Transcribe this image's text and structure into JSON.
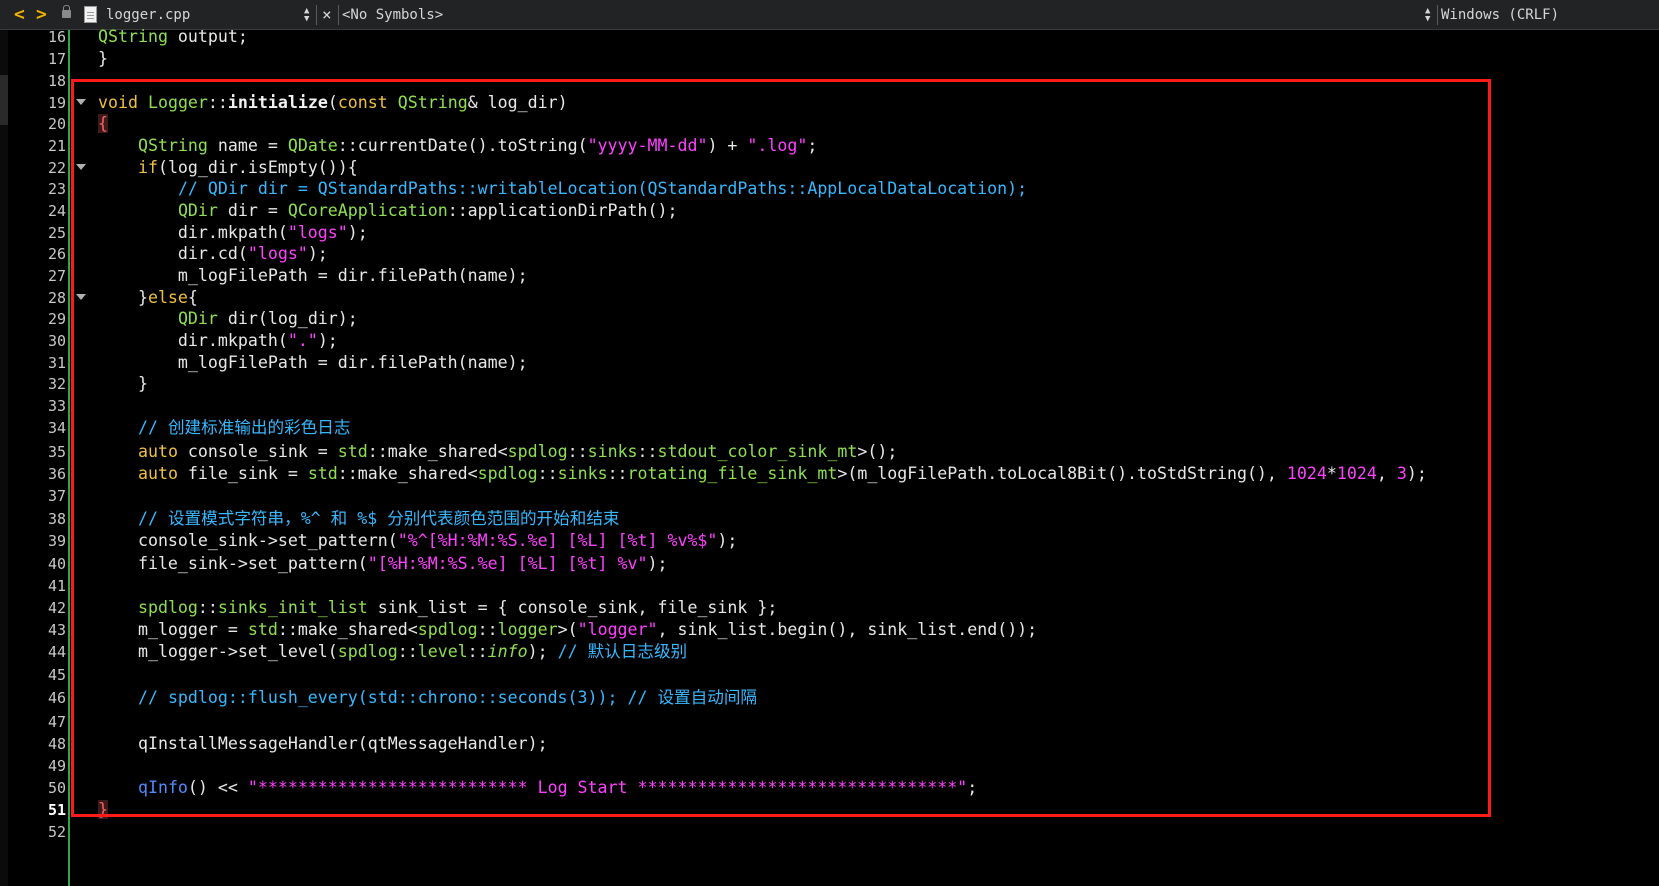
{
  "toolbar": {
    "back_glyph": "<",
    "forward_glyph": ">",
    "file_name": "logger.cpp",
    "close_glyph": "×",
    "symbols": "<No Symbols>",
    "line_ending": "Windows (CRLF)",
    "icons": [
      "back-arrow-icon",
      "forward-arrow-icon",
      "lock-icon",
      "document-icon",
      "updown-icon",
      "close-icon"
    ],
    "accent_color": "#f0b400"
  },
  "editor": {
    "highlight_box_color": "#ff1a1a",
    "change_bar_color": "#2aa84a",
    "lines": [
      {
        "num": "16",
        "fold": false,
        "html": "<span class=\"cls\">QString</span> output;"
      },
      {
        "num": "17",
        "fold": false,
        "html": "}"
      },
      {
        "num": "18",
        "fold": false,
        "html": ""
      },
      {
        "num": "19",
        "fold": true,
        "html": "<span class=\"kw\">void</span> <span class=\"cls\">Logger</span>::<span class=\"fn\">initialize</span>(<span class=\"kw\">const</span> <span class=\"cls\">QString</span>&amp; log_dir)"
      },
      {
        "num": "20",
        "fold": false,
        "html": "<span class=\"brace-err\">{</span>"
      },
      {
        "num": "21",
        "fold": false,
        "html": "    <span class=\"cls\">QString</span> name = <span class=\"cls\">QDate</span>::currentDate().toString(<span class=\"str\">\"yyyy-MM-dd\"</span>) + <span class=\"str\">\".log\"</span>;"
      },
      {
        "num": "22",
        "fold": true,
        "html": "    <span class=\"kw\">if</span>(log_dir.isEmpty()){"
      },
      {
        "num": "23",
        "fold": false,
        "html": "        <span class=\"cmt\">// QDir dir = QStandardPaths::writableLocation(QStandardPaths::AppLocalDataLocation);</span>"
      },
      {
        "num": "24",
        "fold": false,
        "html": "        <span class=\"cls\">QDir</span> dir = <span class=\"cls\">QCoreApplication</span>::applicationDirPath();"
      },
      {
        "num": "25",
        "fold": false,
        "html": "        dir.mkpath(<span class=\"str\">\"logs\"</span>);"
      },
      {
        "num": "26",
        "fold": false,
        "html": "        dir.cd(<span class=\"str\">\"logs\"</span>);"
      },
      {
        "num": "27",
        "fold": false,
        "html": "        m_logFilePath = dir.filePath(name);"
      },
      {
        "num": "28",
        "fold": true,
        "html": "    }<span class=\"kw\">else</span>{"
      },
      {
        "num": "29",
        "fold": false,
        "html": "        <span class=\"cls\">QDir</span> dir(log_dir);"
      },
      {
        "num": "30",
        "fold": false,
        "html": "        dir.mkpath(<span class=\"str\">\".\"</span>);"
      },
      {
        "num": "31",
        "fold": false,
        "html": "        m_logFilePath = dir.filePath(name);"
      },
      {
        "num": "32",
        "fold": false,
        "html": "    }"
      },
      {
        "num": "33",
        "fold": false,
        "html": ""
      },
      {
        "num": "34",
        "fold": false,
        "html": "    <span class=\"cmt\">// 创建标准输出的彩色日志</span>"
      },
      {
        "num": "35",
        "fold": false,
        "html": "    <span class=\"kw\">auto</span> console_sink = <span class=\"cls\">std</span>::make_shared&lt;<span class=\"cls\">spdlog</span>::<span class=\"cls\">sinks</span>::<span class=\"cls\">stdout_color_sink_mt</span>&gt;();"
      },
      {
        "num": "36",
        "fold": false,
        "html": "    <span class=\"kw\">auto</span> file_sink = <span class=\"cls\">std</span>::make_shared&lt;<span class=\"cls\">spdlog</span>::<span class=\"cls\">sinks</span>::<span class=\"cls\">rotating_file_sink_mt</span>&gt;(m_logFilePath.toLocal8Bit().toStdString(), <span class=\"num\">1024</span>*<span class=\"num\">1024</span>, <span class=\"num\">3</span>);"
      },
      {
        "num": "37",
        "fold": false,
        "html": ""
      },
      {
        "num": "38",
        "fold": false,
        "html": "    <span class=\"cmt\">// 设置模式字符串，%^ 和 %$ 分别代表颜色范围的开始和结束</span>"
      },
      {
        "num": "39",
        "fold": false,
        "html": "    console_sink-&gt;set_pattern(<span class=\"str\">\"%^[%H:%M:%S.%e] [%L] [%t] %v%$\"</span>);"
      },
      {
        "num": "40",
        "fold": false,
        "html": "    file_sink-&gt;set_pattern(<span class=\"str\">\"[%H:%M:%S.%e] [%L] [%t] %v\"</span>);"
      },
      {
        "num": "41",
        "fold": false,
        "html": ""
      },
      {
        "num": "42",
        "fold": false,
        "html": "    <span class=\"cls\">spdlog</span>::<span class=\"cls\">sinks_init_list</span> sink_list = { console_sink, file_sink };"
      },
      {
        "num": "43",
        "fold": false,
        "html": "    m_logger = <span class=\"cls\">std</span>::make_shared&lt;<span class=\"cls\">spdlog</span>::<span class=\"cls\">logger</span>&gt;(<span class=\"str\">\"logger\"</span>, sink_list.begin(), sink_list.end());"
      },
      {
        "num": "44",
        "fold": false,
        "html": "    m_logger-&gt;set_level(<span class=\"cls\">spdlog</span>::<span class=\"cls\">level</span>::<span class=\"cls itl\">info</span>); <span class=\"cmt\">// 默认日志级别</span>"
      },
      {
        "num": "45",
        "fold": false,
        "html": ""
      },
      {
        "num": "46",
        "fold": false,
        "html": "    <span class=\"cmt\">// spdlog::flush_every(std::chrono::seconds(3)); // 设置自动间隔</span>"
      },
      {
        "num": "47",
        "fold": false,
        "html": ""
      },
      {
        "num": "48",
        "fold": false,
        "html": "    qInstallMessageHandler(qtMessageHandler);"
      },
      {
        "num": "49",
        "fold": false,
        "html": ""
      },
      {
        "num": "50",
        "fold": false,
        "html": "    <span class=\"mac\">qInfo</span>() &lt;&lt; <span class=\"str\">\"*************************** Log Start ********************************\"</span>;"
      },
      {
        "num": "51",
        "fold": false,
        "html": "<span class=\"brace-err\">}</span>"
      },
      {
        "num": "52",
        "fold": false,
        "html": ""
      }
    ]
  }
}
